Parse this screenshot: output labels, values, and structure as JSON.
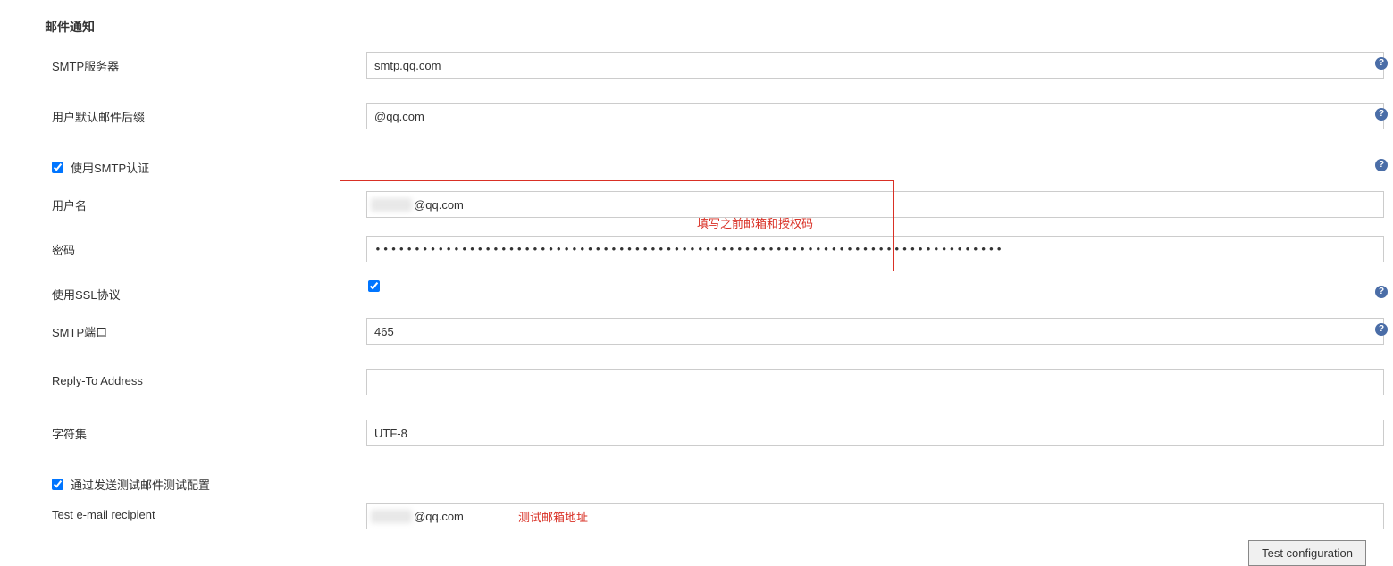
{
  "section_title": "邮件通知",
  "labels": {
    "smtp_server": "SMTP服务器",
    "default_suffix": "用户默认邮件后缀",
    "use_smtp_auth": "使用SMTP认证",
    "username": "用户名",
    "password": "密码",
    "use_ssl": "使用SSL协议",
    "smtp_port": "SMTP端口",
    "reply_to": "Reply-To Address",
    "charset": "字符集",
    "test_by_send": "通过发送测试邮件测试配置",
    "test_recipient": "Test e-mail recipient"
  },
  "values": {
    "smtp_server": "smtp.qq.com",
    "default_suffix": "@qq.com",
    "use_smtp_auth_checked": true,
    "username_mask": "█████",
    "username_suffix": "@qq.com",
    "password_dots": "••••••••••••••••••••••••••••••••••••••••••••••••••••••••••••••••••••••••••••••••",
    "use_ssl_checked": true,
    "smtp_port": "465",
    "reply_to": "",
    "charset": "UTF-8",
    "test_by_send_checked": true,
    "test_recipient_mask": "█████",
    "test_recipient_suffix": "@qq.com"
  },
  "annotations": {
    "fill_before": "填写之前邮箱和授权码",
    "test_addr": "测试邮箱地址"
  },
  "buttons": {
    "test_configuration": "Test configuration"
  }
}
